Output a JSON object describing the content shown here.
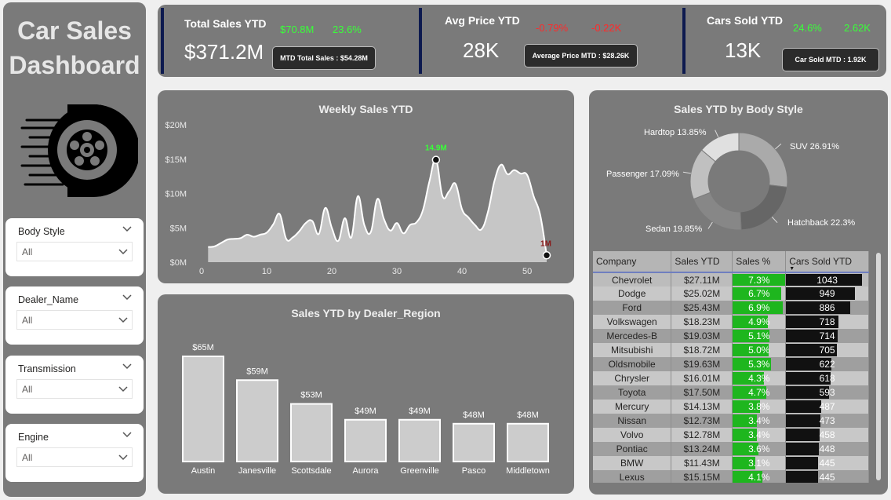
{
  "sidebar": {
    "title_line1": "Car Sales",
    "title_line2": "Dashboard",
    "logo_icon": "car-wheel-speed-icon",
    "filters": [
      {
        "label": "Body Style",
        "value": "All"
      },
      {
        "label": "Dealer_Name",
        "value": "All"
      },
      {
        "label": "Transmission",
        "value": "All"
      },
      {
        "label": "Engine",
        "value": "All"
      }
    ]
  },
  "kpis": [
    {
      "title": "Total Sales YTD",
      "value": "$371.2M",
      "delta1": "$70.8M",
      "delta2": "23.6%",
      "delta_status": "positive",
      "chip": "MTD Total Sales : $54.28M"
    },
    {
      "title": "Avg Price YTD",
      "value": "28K",
      "delta1": "-0.79%",
      "delta2": "-0.22K",
      "delta_status": "negative",
      "chip": "Average Price MTD : $28.26K"
    },
    {
      "title": "Cars Sold YTD",
      "value": "13K",
      "delta1": "24.6%",
      "delta2": "2.62K",
      "delta_status": "positive",
      "chip": "Car Sold MTD : 1.92K"
    }
  ],
  "colors": {
    "positive": "#39ff39",
    "negative": "#ff2a2a",
    "panel": "#7a7a7a",
    "kpi_accent": "#0d1a4f",
    "bar_fill": "#cccccc",
    "pct_bar": "#1eb61e",
    "count_bar": "#111111"
  },
  "chart_data": [
    {
      "type": "area",
      "title": "Weekly Sales YTD",
      "xlabel": "",
      "ylabel": "",
      "xlim": [
        0,
        53
      ],
      "ylim": [
        0,
        20
      ],
      "x_ticks": [
        0,
        10,
        20,
        30,
        40,
        50
      ],
      "y_ticks": [
        "$0M",
        "$5M",
        "$10M",
        "$15M",
        "$20M"
      ],
      "grid": false,
      "x": [
        1,
        2,
        3,
        4,
        5,
        6,
        7,
        8,
        9,
        10,
        11,
        12,
        13,
        14,
        15,
        16,
        17,
        18,
        19,
        20,
        21,
        22,
        23,
        24,
        25,
        26,
        27,
        28,
        29,
        30,
        31,
        32,
        33,
        34,
        35,
        36,
        37,
        38,
        39,
        40,
        41,
        42,
        43,
        44,
        45,
        46,
        47,
        48,
        49,
        50,
        51,
        52,
        53
      ],
      "values": [
        2.2,
        2.3,
        2.8,
        3.3,
        3.4,
        3.5,
        4.0,
        3.7,
        4.0,
        4.3,
        5.5,
        7.0,
        3.4,
        3.6,
        4.5,
        5.7,
        6.0,
        4.1,
        7.9,
        5.0,
        3.1,
        6.4,
        3.6,
        9.6,
        5.4,
        4.4,
        9.2,
        6.3,
        4.6,
        5.7,
        4.2,
        5.4,
        5.8,
        7.6,
        11.8,
        14.9,
        9.6,
        10.3,
        11.4,
        7.7,
        6.5,
        5.4,
        4.8,
        7.4,
        11.9,
        14.2,
        12.8,
        13.4,
        12.9,
        12.7,
        9.6,
        6.9,
        1.0
      ],
      "annotations": [
        {
          "x": 36,
          "y": 14.9,
          "label": "14.9M",
          "color": "#39ff39"
        },
        {
          "x": 53,
          "y": 1.0,
          "label": "1M",
          "color": "#8b1a1a"
        }
      ]
    },
    {
      "type": "bar",
      "title": "Sales YTD by Dealer_Region",
      "categories": [
        "Austin",
        "Janesville",
        "Scottsdale",
        "Aurora",
        "Greenville",
        "Pasco",
        "Middletown"
      ],
      "values": [
        65,
        59,
        53,
        49,
        49,
        48,
        48
      ],
      "data_labels": [
        "$65M",
        "$59M",
        "$53M",
        "$49M",
        "$49M",
        "$48M",
        "$48M"
      ],
      "xlabel": "",
      "ylabel": "",
      "grid": false
    },
    {
      "type": "pie",
      "title": "Sales YTD by Body Style",
      "categories": [
        "SUV",
        "Hatchback",
        "Sedan",
        "Passenger",
        "Hardtop"
      ],
      "values": [
        26.91,
        22.3,
        19.85,
        17.09,
        13.85
      ],
      "labels": [
        "SUV 26.91%",
        "Hatchback 22.3%",
        "Sedan 19.85%",
        "Passenger 17.09%",
        "Hardtop 13.85%"
      ],
      "colors": [
        "#aaaaaa",
        "#666666",
        "#878787",
        "#c0c0c0",
        "#e0e0e0"
      ]
    },
    {
      "type": "table",
      "columns": [
        "Company",
        "Sales YTD",
        "Sales %",
        "Cars Sold YTD"
      ],
      "rows": [
        [
          "Chevrolet",
          "$27.11M",
          "7.3%",
          "1043"
        ],
        [
          "Dodge",
          "$25.02M",
          "6.7%",
          "949"
        ],
        [
          "Ford",
          "$25.43M",
          "6.9%",
          "886"
        ],
        [
          "Volkswagen",
          "$18.23M",
          "4.9%",
          "718"
        ],
        [
          "Mercedes-B",
          "$19.03M",
          "5.1%",
          "714"
        ],
        [
          "Mitsubishi",
          "$18.72M",
          "5.0%",
          "705"
        ],
        [
          "Oldsmobile",
          "$19.63M",
          "5.3%",
          "622"
        ],
        [
          "Chrysler",
          "$16.01M",
          "4.3%",
          "618"
        ],
        [
          "Toyota",
          "$17.50M",
          "4.7%",
          "593"
        ],
        [
          "Mercury",
          "$14.13M",
          "3.8%",
          "487"
        ],
        [
          "Nissan",
          "$12.73M",
          "3.4%",
          "473"
        ],
        [
          "Volvo",
          "$12.78M",
          "3.4%",
          "458"
        ],
        [
          "Pontiac",
          "$13.24M",
          "3.6%",
          "448"
        ],
        [
          "BMW",
          "$11.43M",
          "3.1%",
          "445"
        ],
        [
          "Lexus",
          "$15.15M",
          "4.1%",
          "445"
        ]
      ],
      "sales_pct_values": [
        7.3,
        6.7,
        6.9,
        4.9,
        5.1,
        5.0,
        5.3,
        4.3,
        4.7,
        3.8,
        3.4,
        3.4,
        3.6,
        3.1,
        4.1
      ],
      "cars_sold_values": [
        1043,
        949,
        886,
        718,
        714,
        705,
        622,
        618,
        593,
        487,
        473,
        458,
        448,
        445,
        445
      ],
      "sorted_by": "Cars Sold YTD"
    }
  ]
}
